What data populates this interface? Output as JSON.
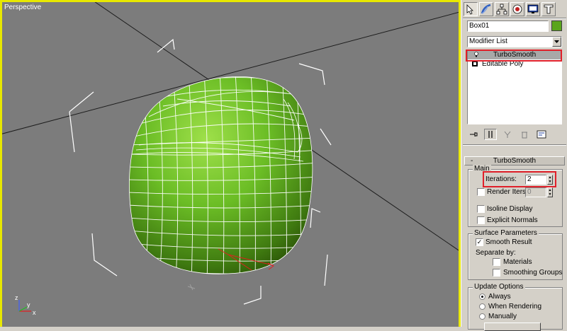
{
  "viewport": {
    "label": "Perspective"
  },
  "panel": {
    "tabs": [
      {
        "icon": "create-icon",
        "active": true
      },
      {
        "icon": "modify-icon",
        "active": false
      },
      {
        "icon": "hierarchy-icon",
        "active": false
      },
      {
        "icon": "motion-icon",
        "active": false
      },
      {
        "icon": "display-icon",
        "active": false
      },
      {
        "icon": "utilities-icon",
        "active": false
      }
    ],
    "object_name": "Box01",
    "object_color": "#5aa51c",
    "modifier_list": "Modifier List",
    "stack": [
      {
        "label": "TurboSmooth",
        "selected": true
      },
      {
        "label": "Editable Poly",
        "selected": false
      }
    ]
  },
  "turbosmooth": {
    "title": "TurboSmooth",
    "collapse": "-",
    "main": {
      "title": "Main",
      "iterations_label": "Iterations:",
      "iterations_value": "2",
      "render_iters_label": "Render Iters:",
      "render_iters_value": "0",
      "render_iters_checked": false,
      "isoline_label": "Isoline Display",
      "isoline_checked": false,
      "explicit_normals_label": "Explicit Normals",
      "explicit_normals_checked": false
    },
    "surface": {
      "title": "Surface Parameters",
      "smooth_result_label": "Smooth Result",
      "smooth_result_checked": true,
      "separate_by_label": "Separate by:",
      "materials_label": "Materials",
      "smoothing_groups_label": "Smoothing Groups"
    },
    "update": {
      "title": "Update Options",
      "always_label": "Always",
      "when_rendering_label": "When Rendering",
      "manually_label": "Manually",
      "selected": "Always"
    }
  },
  "axis": {
    "x": "x",
    "y": "y",
    "z": "z"
  },
  "colors": {
    "highlight": "#e0202a",
    "viewport_border": "#e8e800",
    "mesh": "#5aa51c"
  }
}
